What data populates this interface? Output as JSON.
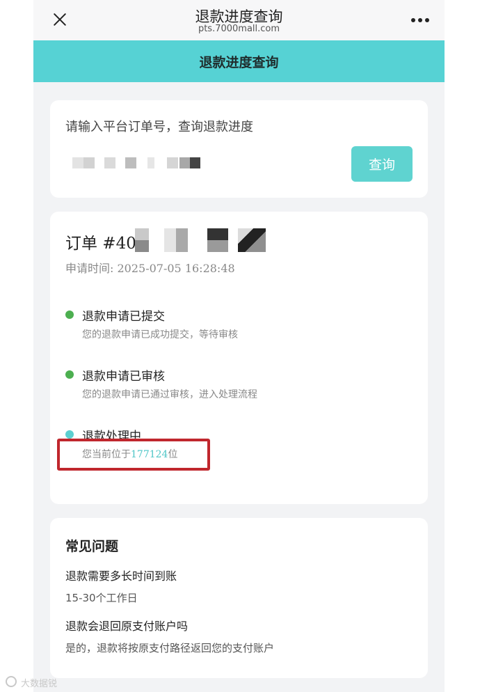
{
  "nav": {
    "title": "退款进度查询",
    "url": "pts.7000mall.com"
  },
  "header": {
    "title": "退款进度查询"
  },
  "search": {
    "label": "请输入平台订单号，查询退款进度",
    "button_label": "查询"
  },
  "order": {
    "title": "订单 #40",
    "apply_time": "申请时间: 2025-07-05 16:28:48"
  },
  "steps": [
    {
      "title": "退款申请已提交",
      "desc": "您的退款申请已成功提交，等待审核",
      "dot_color": "#4caf50"
    },
    {
      "title": "退款申请已审核",
      "desc": "您的退款申请已通过审核，进入处理流程",
      "dot_color": "#4caf50"
    },
    {
      "title": "退款处理中",
      "desc_prefix": "您当前位于",
      "queue_position": "177124",
      "desc_suffix": "位",
      "dot_color": "#5ccfd0"
    }
  ],
  "faq": {
    "title": "常见问题",
    "items": [
      {
        "q": "退款需要多长时间到账",
        "a": "15-30个工作日"
      },
      {
        "q": "退款会退回原支付账户吗",
        "a": "是的，退款将按原支付路径返回您的支付账户"
      }
    ]
  },
  "watermark": {
    "left": "大数据锐",
    "right": ""
  },
  "colors": {
    "accent": "#56d2d4",
    "button": "#5fd3d0",
    "highlight": "#c0272d"
  }
}
